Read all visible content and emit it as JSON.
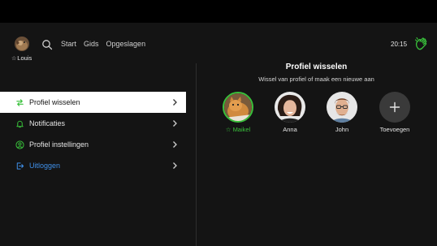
{
  "header": {
    "user_name": "Louis",
    "nav": [
      "Start",
      "Gids",
      "Opgeslagen"
    ],
    "clock": "20:15",
    "icons": {
      "search": "search-icon",
      "brand": "hand-wave-icon",
      "favorite": "star-outline-icon"
    }
  },
  "menu": {
    "items": [
      {
        "label": "Profiel wisselen",
        "icon": "switch-arrows-icon",
        "active": true
      },
      {
        "label": "Notificaties",
        "icon": "bell-icon",
        "active": false
      },
      {
        "label": "Profiel instellingen",
        "icon": "person-circle-icon",
        "active": false
      },
      {
        "label": "Uitloggen",
        "icon": "logout-icon",
        "active": false
      }
    ]
  },
  "panel": {
    "title": "Profiel wisselen",
    "subtitle": "Wissel van profiel of maak een nieuwe aan",
    "profiles": [
      {
        "name": "Maikel",
        "active": true
      },
      {
        "name": "Anna",
        "active": false
      },
      {
        "name": "John",
        "active": false
      }
    ],
    "add_label": "Toevoegen"
  },
  "colors": {
    "accent_green": "#39c03b",
    "logout_blue": "#3f8fe8",
    "background": "#141414"
  }
}
